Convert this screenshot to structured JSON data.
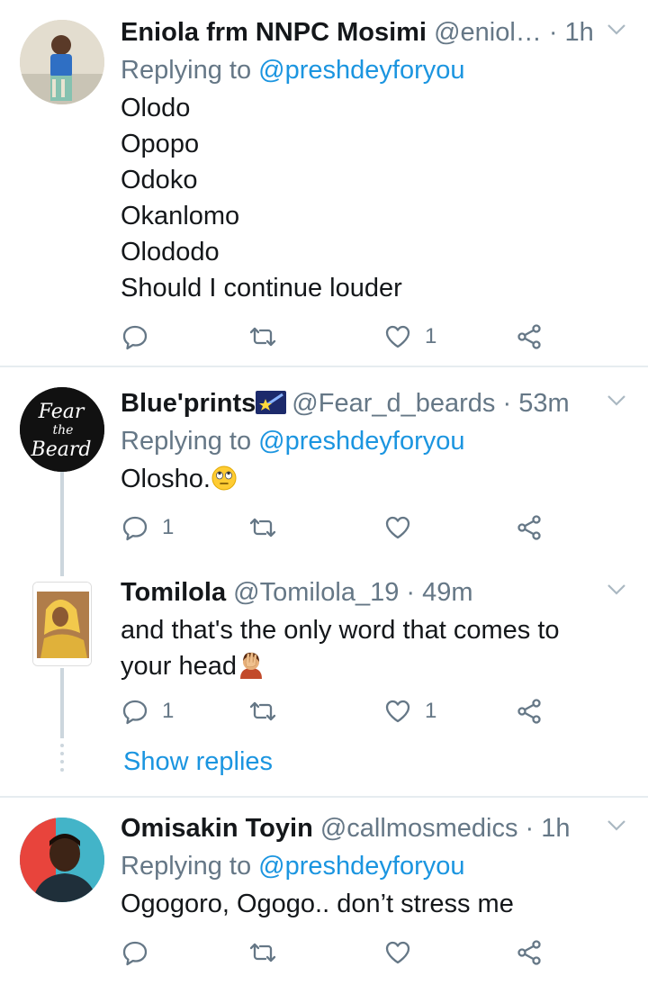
{
  "tweets": [
    {
      "name": "Eniola frm NNPC Mosimi",
      "handle": "@eniol…",
      "time": "· 1h",
      "replying_label": "Replying to",
      "replying_to": "@preshdeyforyou",
      "lines": [
        "Olodo",
        "Opopo",
        "Odoko",
        "Okanlomo",
        "Olododo",
        "Should I continue louder"
      ],
      "reply_count": "",
      "like_count": "1",
      "avatar_icon": "user-avatar-child"
    },
    {
      "name": "Blue'prints",
      "name_emoji": "shooting-star-emoji",
      "handle": "@Fear_d_beards",
      "time": "· 53m",
      "replying_label": "Replying to",
      "replying_to": "@preshdeyforyou",
      "text": "Olosho.",
      "text_emoji": "eye-roll-emoji",
      "reply_count": "1",
      "like_count": "",
      "avatar_text": [
        "Fear",
        "the",
        "Beard"
      ]
    },
    {
      "name": "Tomilola",
      "handle": "@Tomilola_19",
      "time": "· 49m",
      "lines": [
        "and that's the only word that comes to",
        "your head"
      ],
      "text_emoji": "facepalm-emoji",
      "reply_count": "1",
      "like_count": "1",
      "avatar_icon": "user-avatar-woman"
    },
    {
      "name": "Omisakin Toyin",
      "handle": "@callmosmedics",
      "time": "· 1h",
      "replying_label": "Replying to",
      "replying_to": "@preshdeyforyou",
      "text": "Ogogoro, Ogogo.. don’t stress me",
      "reply_count": "",
      "like_count": "",
      "avatar_icon": "user-avatar-man"
    }
  ],
  "show_replies": "Show replies",
  "colors": {
    "link": "#1b95e0",
    "muted": "#657786",
    "text": "#14171a",
    "divider": "#e6ecf0"
  }
}
